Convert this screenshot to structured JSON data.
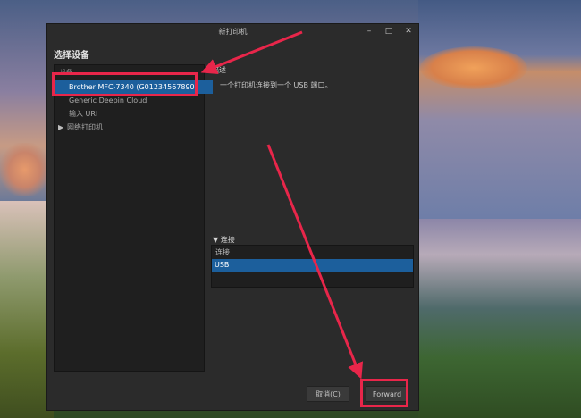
{
  "window": {
    "title": "新打印机"
  },
  "heading": "选择设备",
  "devices": {
    "header": "设备",
    "items": [
      {
        "label": "Brother MFC-7340 (G01234567890)",
        "selected": true
      },
      {
        "label": "Generic Deepin Cloud",
        "selected": false
      },
      {
        "label": "输入 URI",
        "selected": false
      },
      {
        "label": "网络打印机",
        "selected": false,
        "expandable": true
      }
    ]
  },
  "description": {
    "title": "描述",
    "text": "一个打印机连接到一个 USB 端口。"
  },
  "connection": {
    "toggle_label": "连接",
    "column_header": "连接",
    "selected_value": "USB"
  },
  "buttons": {
    "cancel": "取消(C)",
    "forward": "Forward"
  },
  "colors": {
    "selection": "#1c5f9c",
    "annotation": "#e8264a"
  }
}
